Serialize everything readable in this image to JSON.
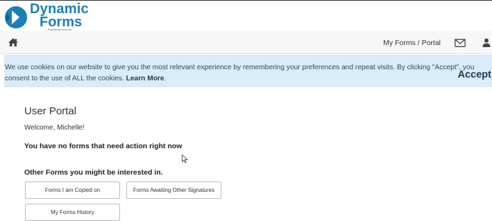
{
  "brand": {
    "name_line1": "Dynamic",
    "name_line2": "Forms",
    "tagline": "Powered by Next Gen"
  },
  "navbar": {
    "home_icon": "home-icon",
    "portal_link": "My Forms / Portal",
    "mail_icon": "mail-icon",
    "user_icon": "user-icon"
  },
  "cookie_banner": {
    "text": "We use cookies on our website to give you the most relevant experience by remembering your preferences and repeat visits. By clicking \"Accept\", you consent to the use of ALL the cookies.",
    "learn_more": "Learn More",
    "period": ".",
    "accept_label": "Accept"
  },
  "portal": {
    "title": "User Portal",
    "welcome": "Welcome, Michelle!",
    "no_forms_message": "You have no forms that need action right now",
    "other_forms_heading": "Other Forms you might be interested in.",
    "buttons": [
      {
        "label": "Forms I am Copied on"
      },
      {
        "label": "Forms Awaiting Other Signatures"
      },
      {
        "label": "My Forms History"
      }
    ]
  },
  "colors": {
    "brand_blue": "#1a7fb8",
    "banner_bg": "#d9ecf7",
    "navbar_bg": "#f7f7f7"
  }
}
